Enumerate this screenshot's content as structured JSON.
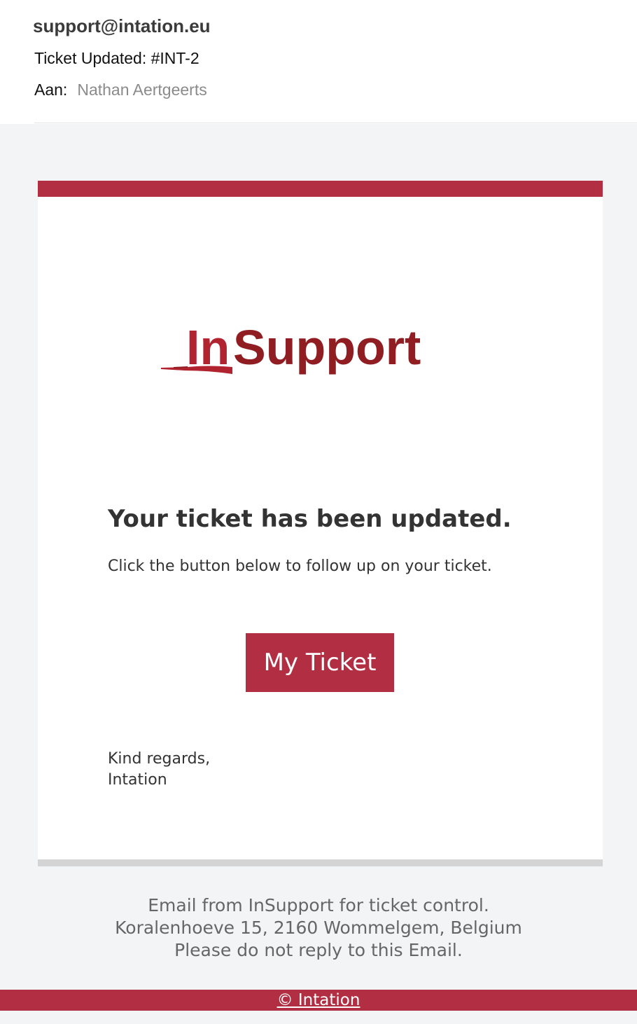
{
  "email": {
    "from": "support@intation.eu",
    "subject": "Ticket Updated: #INT-2",
    "to_label": "Aan:",
    "to_name": "Nathan Aertgeerts"
  },
  "logo": {
    "text_in": "In",
    "text_support": "Support",
    "color_dark": "#8f1d22",
    "color_light": "#b22330",
    "icon": "insupport-logo"
  },
  "card": {
    "heading": "Your ticket has been updated.",
    "text": "Click the button below to follow up on your ticket.",
    "button_label": "My Ticket",
    "signoff_line1": "Kind regards,",
    "signoff_line2": "Intation"
  },
  "footer": {
    "line1": "Email from InSupport for ticket control.",
    "line2": "Koralenhoeve 15, 2160 Wommelgem, Belgium",
    "line3": "Please do not reply to this Email.",
    "copyright": "© Intation"
  },
  "colors": {
    "accent": "#b22f43",
    "background": "#f3f4f6",
    "card": "#ffffff"
  }
}
